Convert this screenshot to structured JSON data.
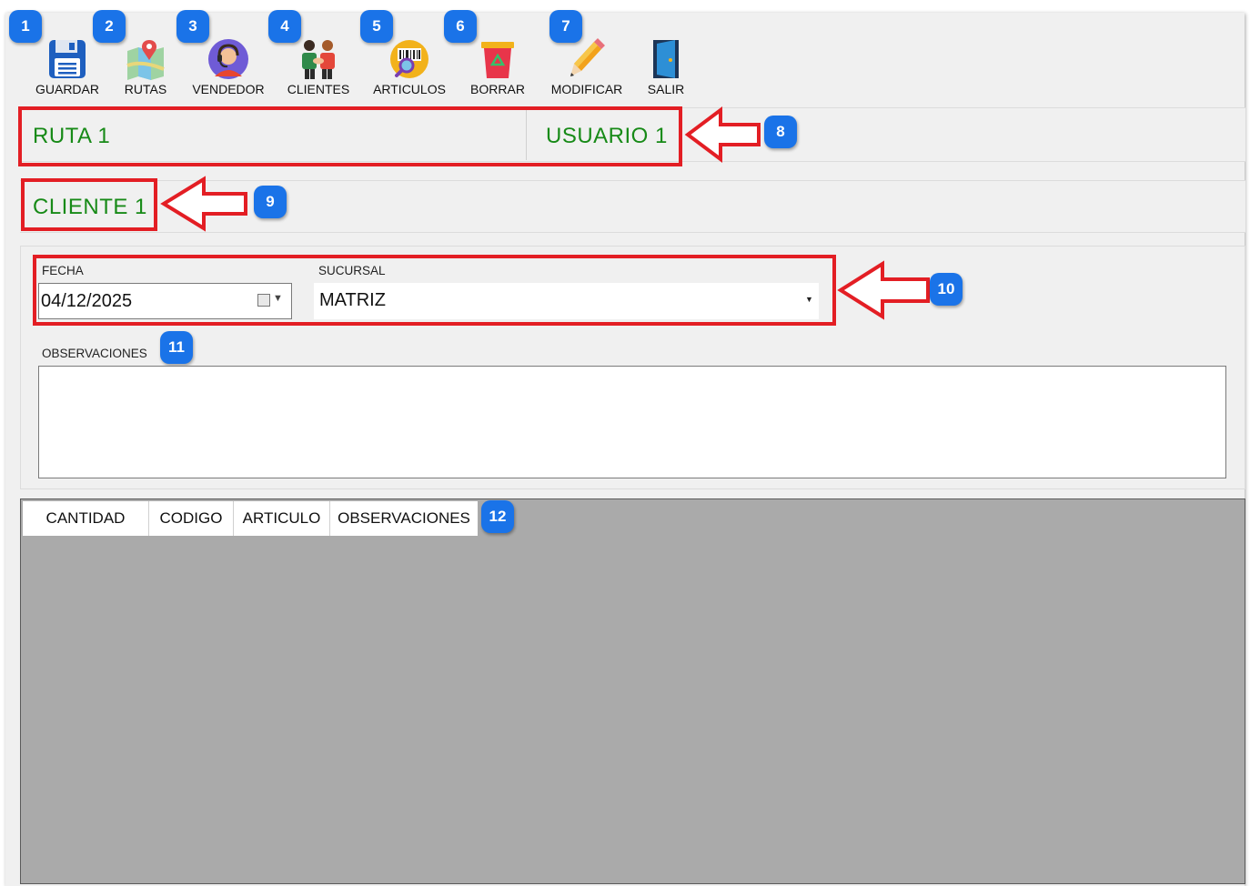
{
  "toolbar": {
    "items": [
      {
        "label": "GUARDAR",
        "icon": "floppy-disk-icon",
        "badge": "1"
      },
      {
        "label": "RUTAS",
        "icon": "map-pin-icon",
        "badge": "2"
      },
      {
        "label": "VENDEDOR",
        "icon": "salesperson-icon",
        "badge": "3"
      },
      {
        "label": "CLIENTES",
        "icon": "handshake-icon",
        "badge": "4"
      },
      {
        "label": "ARTICULOS",
        "icon": "barcode-search-icon",
        "badge": "5"
      },
      {
        "label": "BORRAR",
        "icon": "trash-bin-icon",
        "badge": "6"
      },
      {
        "label": "MODIFICAR",
        "icon": "pencil-icon",
        "badge": "7"
      },
      {
        "label": "SALIR",
        "icon": "exit-door-icon",
        "badge": ""
      }
    ]
  },
  "header": {
    "route": "RUTA 1",
    "user": "USUARIO 1",
    "badge": "8"
  },
  "client": {
    "name": "CLIENTE 1",
    "badge": "9"
  },
  "form": {
    "date_label": "FECHA",
    "date_value": "04/12/2025",
    "branch_label": "SUCURSAL",
    "branch_value": "MATRIZ",
    "badge": "10",
    "notes_label": "OBSERVACIONES",
    "notes_value": "",
    "notes_badge": "11"
  },
  "grid": {
    "columns": [
      "CANTIDAD",
      "CODIGO",
      "ARTICULO",
      "OBSERVACIONES"
    ],
    "badge": "12"
  },
  "colors": {
    "accent_green": "#178a17",
    "highlight_red": "#e31e24",
    "badge_blue": "#1a73e8",
    "grid_bg": "#aaaaaa"
  }
}
